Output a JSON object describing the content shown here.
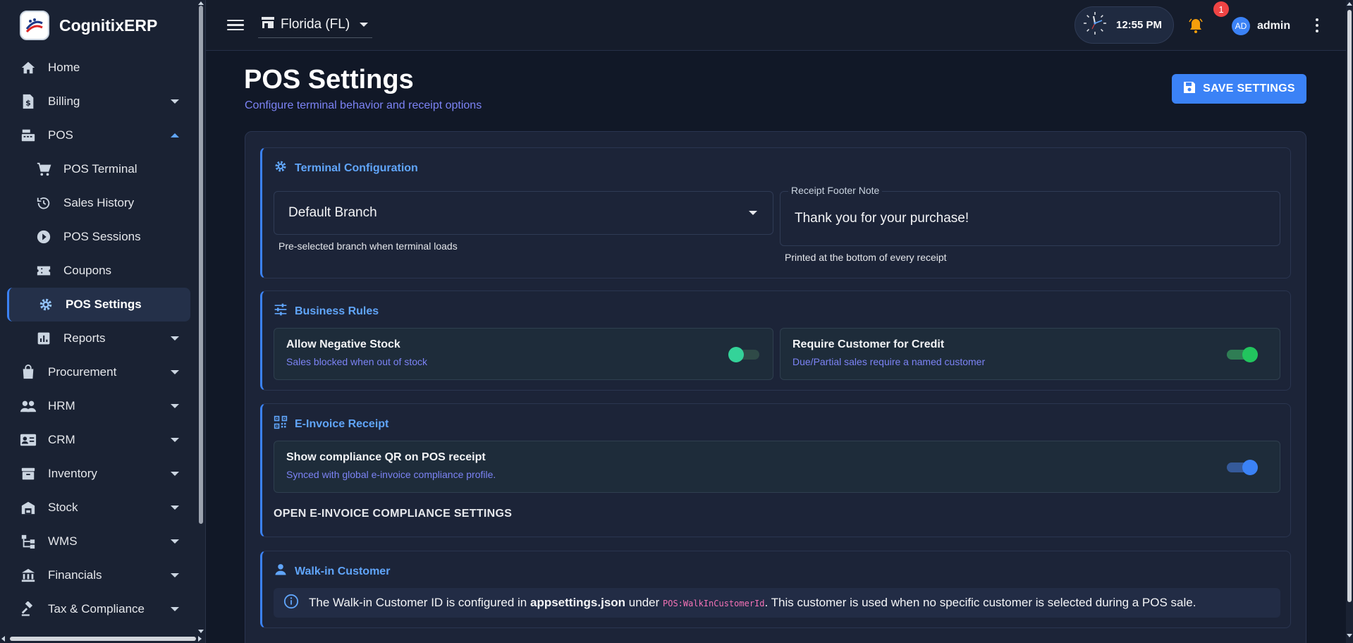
{
  "app": {
    "name": "CognitixERP"
  },
  "sidebar": {
    "items": [
      {
        "label": "Home",
        "icon": "home-icon"
      },
      {
        "label": "Billing",
        "icon": "invoice-dollar-icon"
      },
      {
        "label": "POS",
        "icon": "cash-register-icon"
      },
      {
        "label": "POS Terminal",
        "icon": "cart-icon"
      },
      {
        "label": "Sales History",
        "icon": "history-icon"
      },
      {
        "label": "POS Sessions",
        "icon": "play-circle-icon"
      },
      {
        "label": "Coupons",
        "icon": "ticket-icon"
      },
      {
        "label": "POS Settings",
        "icon": "gear-icon"
      },
      {
        "label": "Reports",
        "icon": "bar-chart-icon"
      },
      {
        "label": "Procurement",
        "icon": "shopping-bag-icon"
      },
      {
        "label": "HRM",
        "icon": "people-icon"
      },
      {
        "label": "CRM",
        "icon": "contact-card-icon"
      },
      {
        "label": "Inventory",
        "icon": "archive-box-icon"
      },
      {
        "label": "Stock",
        "icon": "warehouse-icon"
      },
      {
        "label": "WMS",
        "icon": "hierarchy-icon"
      },
      {
        "label": "Financials",
        "icon": "bank-icon"
      },
      {
        "label": "Tax & Compliance",
        "icon": "gavel-icon"
      }
    ]
  },
  "header": {
    "branch": "Florida (FL)",
    "time": "12:55 PM",
    "notification_count": "1",
    "avatar_initials": "AD",
    "username": "admin"
  },
  "page": {
    "title": "POS Settings",
    "subtitle": "Configure terminal behavior and receipt options",
    "save_label": "SAVE SETTINGS"
  },
  "terminal": {
    "title": "Terminal Configuration",
    "branch_value": "Default Branch",
    "branch_helper": "Pre-selected branch when terminal loads",
    "footer_label": "Receipt Footer Note",
    "footer_value": "Thank you for your purchase!",
    "footer_helper": "Printed at the bottom of every receipt"
  },
  "business_rules": {
    "title": "Business Rules",
    "negative_stock": {
      "title": "Allow Negative Stock",
      "desc": "Sales blocked when out of stock",
      "enabled": false
    },
    "require_customer": {
      "title": "Require Customer for Credit",
      "desc": "Due/Partial sales require a named customer",
      "enabled": true
    }
  },
  "einvoice": {
    "title": "E-Invoice Receipt",
    "qr_title": "Show compliance QR on POS receipt",
    "qr_desc": "Synced with global e-invoice compliance profile.",
    "qr_enabled": true,
    "link_label": "OPEN E-INVOICE COMPLIANCE SETTINGS"
  },
  "walkin": {
    "title": "Walk-in Customer",
    "text_1": "The Walk-in Customer ID is configured in ",
    "bold": "appsettings.json",
    "text_2": " under ",
    "code": "POS:WalkInCustomerId",
    "text_3": ". This customer is used when no specific customer is selected during a POS sale."
  },
  "colors": {
    "accent": "#3b82f6",
    "success": "#22c55e",
    "subtitle": "#7c83f5",
    "badge": "#ef4444",
    "bell": "#f59e0b"
  }
}
